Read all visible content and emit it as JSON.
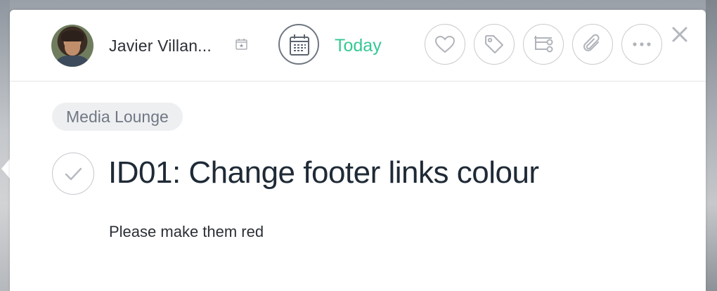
{
  "task": {
    "assignee_name": "Javier Villan...",
    "due_label": "Today",
    "project": "Media Lounge",
    "title": "ID01: Change footer links colour",
    "description": "Please make them red"
  },
  "colors": {
    "accent_due": "#34c993",
    "title_text": "#1f2a36",
    "icon_stroke": "#b0b4ba",
    "pill_bg": "#eeeff1"
  },
  "toolbar_icons": [
    "heart-icon",
    "tag-icon",
    "subtask-icon",
    "paperclip-icon",
    "more-icon"
  ]
}
